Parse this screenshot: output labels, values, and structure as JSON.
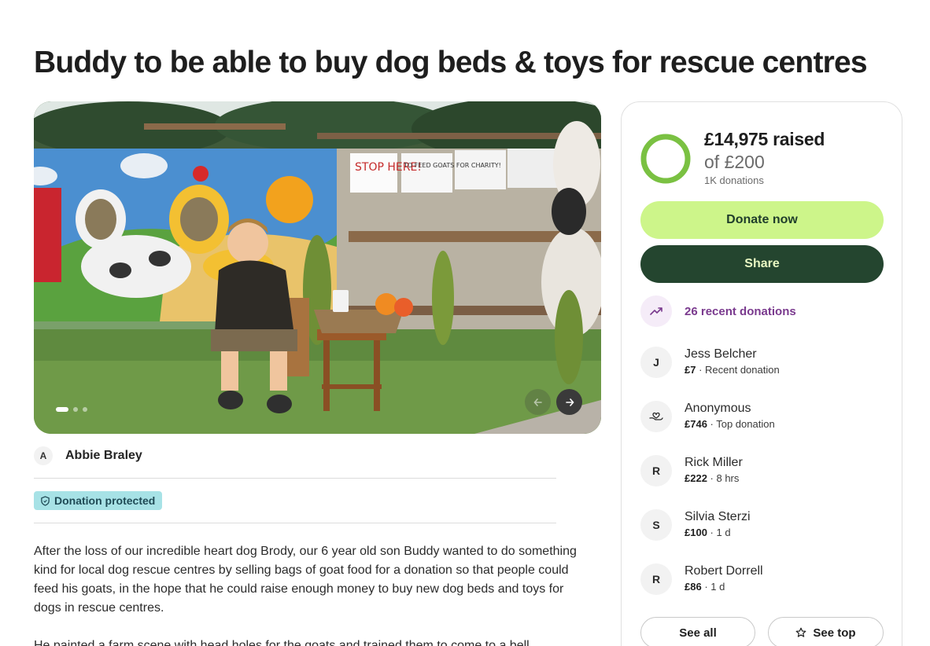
{
  "page": {
    "title": "Buddy to be able to buy dog beds & toys for rescue centres"
  },
  "hero": {
    "sign_stop": "STOP HERE!",
    "sign_feed": "TO FEED GOATS FOR CHARITY!",
    "icons": {
      "prev": "chevron-left-icon",
      "next": "chevron-right-icon"
    }
  },
  "organizer": {
    "initial": "A",
    "name": "Abbie Braley"
  },
  "badge": {
    "label": "Donation protected",
    "icon": "shield-icon"
  },
  "story": {
    "paragraph_1": "After the loss of our incredible heart dog Brody, our 6 year old son Buddy wanted to do something kind for local dog rescue centres by selling bags of goat food for a donation so that people could feed his goats, in the hope that he could raise enough money to buy new dog beds and toys for dogs in rescue centres.",
    "paragraph_2": "He painted a farm scene with head holes for the goats and trained them to come to a bell"
  },
  "progress": {
    "raised": "£14,975 raised",
    "goal": "of £200",
    "donations_count": "1K donations",
    "fraction": 1.0,
    "ring_color": "#7ac142"
  },
  "actions": {
    "donate": "Donate now",
    "share": "Share"
  },
  "recent": {
    "label": "26 recent donations",
    "icon": "trending-up-icon"
  },
  "donations": [
    {
      "initial": "J",
      "name": "Jess Belcher",
      "amount": "£7",
      "meta": " · Recent donation"
    },
    {
      "initial": "",
      "icon": "heart-hand-icon",
      "name": "Anonymous",
      "amount": "£746",
      "meta": " · Top donation"
    },
    {
      "initial": "R",
      "name": "Rick Miller",
      "amount": "£222",
      "meta": " · 8 hrs"
    },
    {
      "initial": "S",
      "name": "Silvia Sterzi",
      "amount": "£100",
      "meta": " · 1 d"
    },
    {
      "initial": "R",
      "name": "Robert Dorrell",
      "amount": "£86",
      "meta": " · 1 d"
    }
  ],
  "footer_buttons": {
    "see_all": "See all",
    "see_top": "See top",
    "see_top_icon": "star-icon"
  },
  "colors": {
    "donate_bg": "#cdf58a",
    "share_bg": "#24452f",
    "protected_bg": "#a7e2e6",
    "recent_text": "#7a3a8e"
  }
}
